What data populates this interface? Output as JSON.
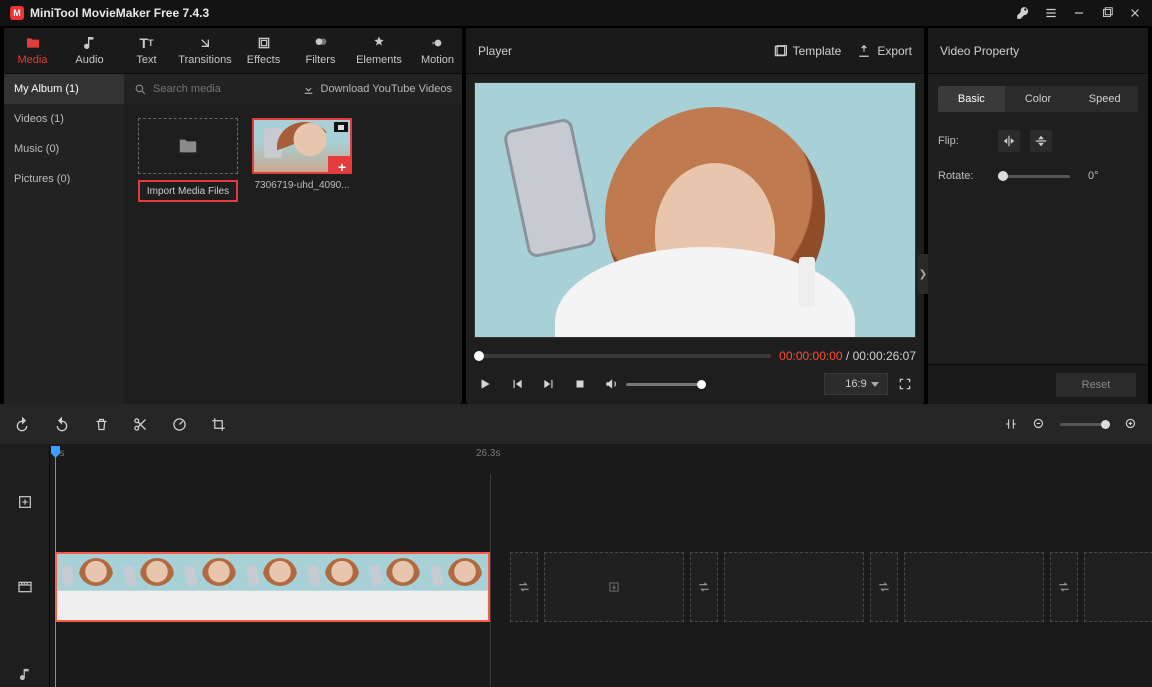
{
  "app": {
    "title": "MiniTool MovieMaker Free 7.4.3"
  },
  "toolTabs": {
    "media": "Media",
    "audio": "Audio",
    "text": "Text",
    "transitions": "Transitions",
    "effects": "Effects",
    "filters": "Filters",
    "elements": "Elements",
    "motion": "Motion"
  },
  "sidebar": {
    "myAlbum": "My Album (1)",
    "videos": "Videos (1)",
    "music": "Music (0)",
    "pictures": "Pictures (0)"
  },
  "mediaBar": {
    "searchPlaceholder": "Search media",
    "download": "Download YouTube Videos"
  },
  "mediaGrid": {
    "importLabel": "Import Media Files",
    "clip1Label": "7306719-uhd_4090...",
    "addGlyph": "+"
  },
  "playerHeader": {
    "title": "Player",
    "template": "Template",
    "export": "Export"
  },
  "playerTime": {
    "current": "00:00:00:00",
    "separator": " / ",
    "duration": "00:00:26:07"
  },
  "playerControls": {
    "ratio": "16:9"
  },
  "propPanel": {
    "title": "Video Property",
    "tabs": {
      "basic": "Basic",
      "color": "Color",
      "speed": "Speed"
    },
    "flipLabel": "Flip:",
    "rotateLabel": "Rotate:",
    "rotateValue": "0°",
    "reset": "Reset"
  },
  "ruler": {
    "t0": "0s",
    "t1": "26.3s"
  }
}
